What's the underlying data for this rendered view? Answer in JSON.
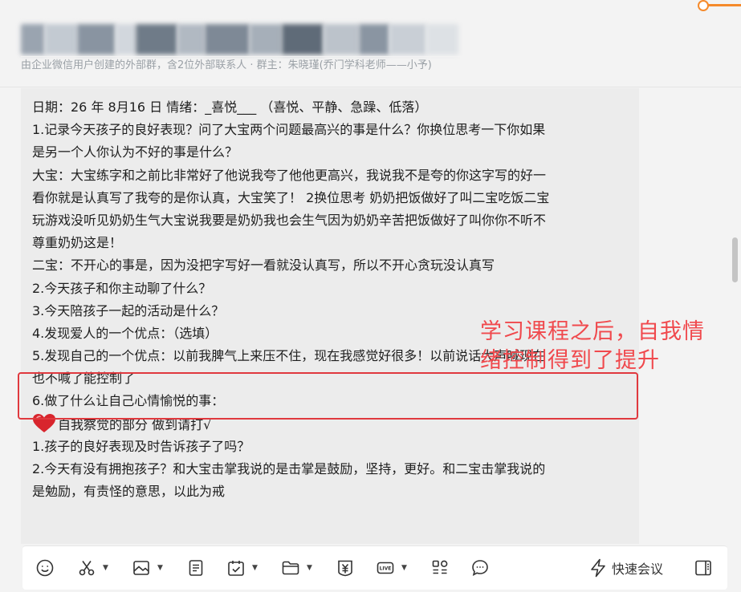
{
  "header": {
    "subtitle": "由企业微信用户创建的外部群，含2位外部联系人 · 群主：朱晓瑾(乔门学科老师——小予)"
  },
  "message": {
    "lines": [
      "日期：26 年 8月16 日 情绪：_喜悦___ （喜悦、平静、急躁、低落）",
      "1.记录今天孩子的良好表现？问了大宝两个问题最高兴的事是什么？你换位思考一下你如果",
      "是另一个人你认为不好的事是什么？",
      "大宝：大宝练字和之前比非常好了他说我夸了他他更高兴，我说我不是夸的你这字写的好一",
      "看你就是认真写了我夸的是你认真，大宝笑了！ 2换位思考 奶奶把饭做好了叫二宝吃饭二宝",
      "玩游戏没听见奶奶生气大宝说我要是奶奶我也会生气因为奶奶辛苦把饭做好了叫你你不听不",
      "尊重奶奶这是！",
      "二宝：不开心的事是，因为没把字写好一看就没认真写，所以不开心贪玩没认真写",
      "2.今天孩子和你主动聊了什么？",
      "3.今天陪孩子一起的活动是什么？",
      "4.发现爱人的一个优点：（选填）",
      "5.发现自己的一个优点：以前我脾气上来压不住，现在我感觉好很多！以前说话大声喊现在",
      "也不喊了能控制了",
      "6.做了什么让自己心情愉悦的事：",
      "",
      "1.孩子的良好表现及时告诉孩子了吗？",
      "2.今天有没有拥抱孩子？和大宝击掌我说的是击掌是鼓励，坚持，更好。和二宝击掌我说的",
      "是勉励，有责怪的意思，以此为戒"
    ],
    "heart_line_text": "自我察觉的部分 做到请打√"
  },
  "annotation": {
    "line1": "学习课程之后，自我情",
    "line2": "绪控制得到了提升",
    "color": "#f0494d"
  },
  "toolbar": {
    "items": [
      "emoji-icon",
      "scissors-icon",
      "image-icon",
      "document-icon",
      "calendar-icon",
      "folder-icon",
      "payment-icon",
      "live-icon",
      "apps-icon",
      "chat-bubble-icon"
    ],
    "live_label": "LIVE",
    "quick_meeting_label": "快速会议"
  }
}
